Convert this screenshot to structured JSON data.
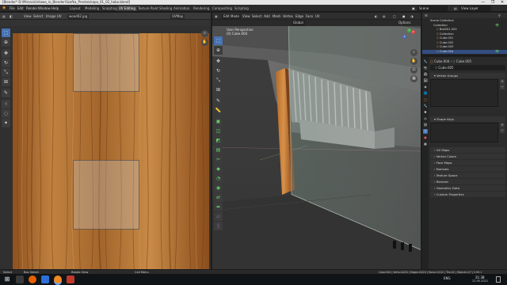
{
  "titlebar": {
    "title": "[Blender* D:\\Mirona\\Ustawa_in_Blender\\Szafka_Prosta\\skapa_01_02_hobo.blend]",
    "minimize": "—",
    "maximize": "❐",
    "close": "✕"
  },
  "menubar": {
    "items": [
      "File",
      "Edit",
      "Render",
      "Window",
      "Help"
    ],
    "workspace_tabs": [
      "Layout",
      "Modeling",
      "Sculpting",
      "UV Editing",
      "Texture Paint",
      "Shading",
      "Animation",
      "Rendering",
      "Compositing",
      "Scripting"
    ],
    "active_tab": "UV Editing",
    "scene_label": "Scene",
    "view_layer_label": "View Layer"
  },
  "uv_editor": {
    "mode": "UV Editor",
    "menus": [
      "View",
      "Select",
      "Image",
      "UV"
    ],
    "image_name": "wood02.jpg",
    "uvmap": "UVMap"
  },
  "viewport": {
    "mode": "Edit Mode",
    "menus": [
      "View",
      "Select",
      "Add",
      "Mesh",
      "Vertex",
      "Edge",
      "Face",
      "UV"
    ],
    "orientation": "Global",
    "overlay_line1": "User Perspective",
    "overlay_line2": "(0) Cube.004",
    "options_label": "Options"
  },
  "outliner": {
    "rows": [
      {
        "name": "Scene Collection",
        "indent": 0,
        "selected": false
      },
      {
        "name": "Collection",
        "indent": 1,
        "selected": false
      },
      {
        "name": "Bok001.003",
        "indent": 2,
        "selected": false
      },
      {
        "name": "Collection",
        "indent": 2,
        "selected": false
      },
      {
        "name": "Cube.001",
        "indent": 2,
        "selected": false
      },
      {
        "name": "Cube.002",
        "indent": 2,
        "selected": false
      },
      {
        "name": "Cube.003",
        "indent": 2,
        "selected": false
      },
      {
        "name": "Cube.004",
        "indent": 2,
        "selected": true
      }
    ]
  },
  "properties": {
    "object_name": "Cube.004",
    "mesh_name": "Cube.005",
    "data_field": "Cube.005",
    "panels": [
      "Vertex Groups",
      "Shape Keys",
      "UV Maps",
      "Vertex Colors",
      "Face Maps",
      "Normals",
      "Texture Space",
      "Remesh",
      "Geometry Data",
      "Custom Properties"
    ]
  },
  "statusbar": {
    "left1": "Select",
    "left2": "Box Select",
    "left3": "Rotate View",
    "left4": "Call Menu",
    "stats": "Cube.004 | Verts:24/24 | Edges:24/24 | Faces:12/12 | Tris:24 | Objects:1/7 | 2.93.1"
  },
  "taskbar": {
    "time": "21:38",
    "date": "22.05.2021",
    "lang": "ENG"
  },
  "colors": {
    "accent": "#4772b3",
    "wood_light": "#b97b3b",
    "wood_dark": "#7a4418"
  }
}
